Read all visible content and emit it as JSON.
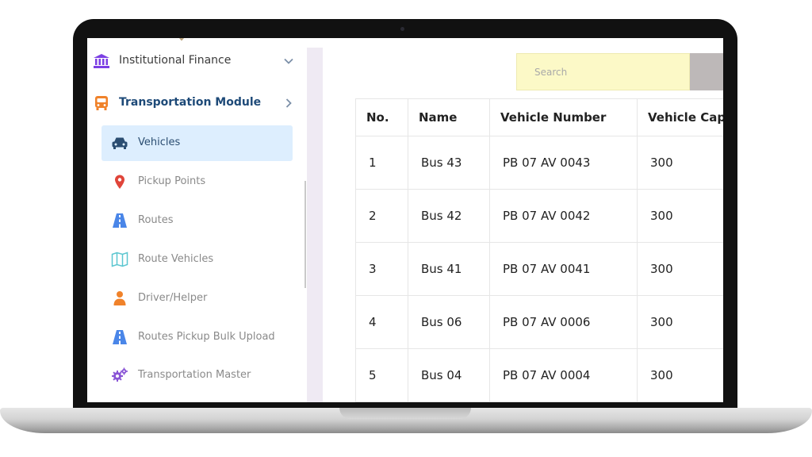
{
  "sidebar": {
    "sections": [
      {
        "label": "Institutional Finance",
        "icon": "bank-icon",
        "expanded": false
      },
      {
        "label": "Transportation Module",
        "icon": "bus-icon",
        "expanded": true
      }
    ],
    "items": [
      {
        "label": "Vehicles",
        "icon": "car-icon",
        "active": true
      },
      {
        "label": "Pickup Points",
        "icon": "map-pin-icon",
        "active": false
      },
      {
        "label": "Routes",
        "icon": "road-icon",
        "active": false
      },
      {
        "label": "Route Vehicles",
        "icon": "map-icon",
        "active": false
      },
      {
        "label": "Driver/Helper",
        "icon": "person-icon",
        "active": false
      },
      {
        "label": "Routes Pickup Bulk Upload",
        "icon": "road-icon",
        "active": false
      },
      {
        "label": "Transportation Master",
        "icon": "gears-icon",
        "active": false
      }
    ]
  },
  "search": {
    "placeholder": "Search"
  },
  "table": {
    "headers": [
      "No.",
      "Name",
      "Vehicle Number",
      "Vehicle Capa"
    ],
    "rows": [
      [
        "1",
        "Bus 43",
        "PB 07 AV 0043",
        "300"
      ],
      [
        "2",
        "Bus 42",
        "PB 07 AV 0042",
        "300"
      ],
      [
        "3",
        "Bus 41",
        "PB 07 AV 0041",
        "300"
      ],
      [
        "4",
        "Bus 06",
        "PB 07 AV 0006",
        "300"
      ],
      [
        "5",
        "Bus 04",
        "PB 07 AV 0004",
        "300"
      ]
    ]
  },
  "colors": {
    "active_bg": "#ddeefe",
    "section_title": "#1e4a78",
    "search_bg": "#fcf9c7",
    "search_button": "#bdb8b8",
    "finance_icon": "#7b3fe4",
    "bus_icon": "#f0822a",
    "pin_icon": "#e0453a",
    "road_icon": "#4a86e8",
    "map_icon": "#5bc6d0",
    "person_icon": "#f0822a",
    "gears_icon": "#8a55d6"
  }
}
